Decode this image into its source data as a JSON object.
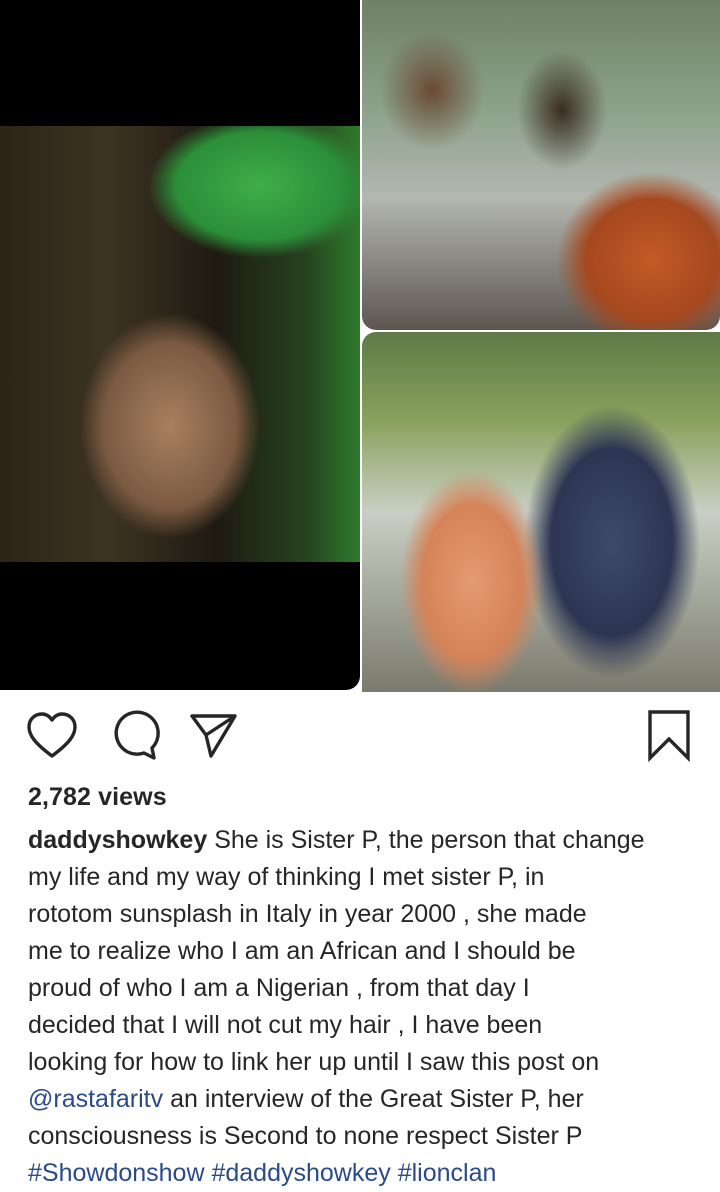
{
  "post": {
    "views": "2,782 views",
    "username": "daddyshowkey",
    "caption_lines": [
      "She is Sister P, the person that change",
      "my life and my way of thinking I met sister P, in",
      "rototom sunsplash in Italy in year 2000 , she made",
      "me to realize  who I am an African and I should be",
      "proud of who I am a Nigerian , from that day I",
      "decided that I will not cut my hair , I have been",
      "looking for how to link her up until I saw this post on"
    ],
    "mention": "@rastafaritv",
    "caption_after_mention": " an interview of the Great Sister P, her",
    "caption_line_9": "consciousness is Second to none  respect Sister P",
    "hashtags": "#Showdonshow #daddyshowkey #lionclan"
  },
  "icons": {
    "like": "heart-icon",
    "comment": "comment-icon",
    "share": "send-icon",
    "save": "bookmark-icon"
  },
  "colors": {
    "text": "#262626",
    "link": "#2a4a8a",
    "background": "#ffffff"
  }
}
